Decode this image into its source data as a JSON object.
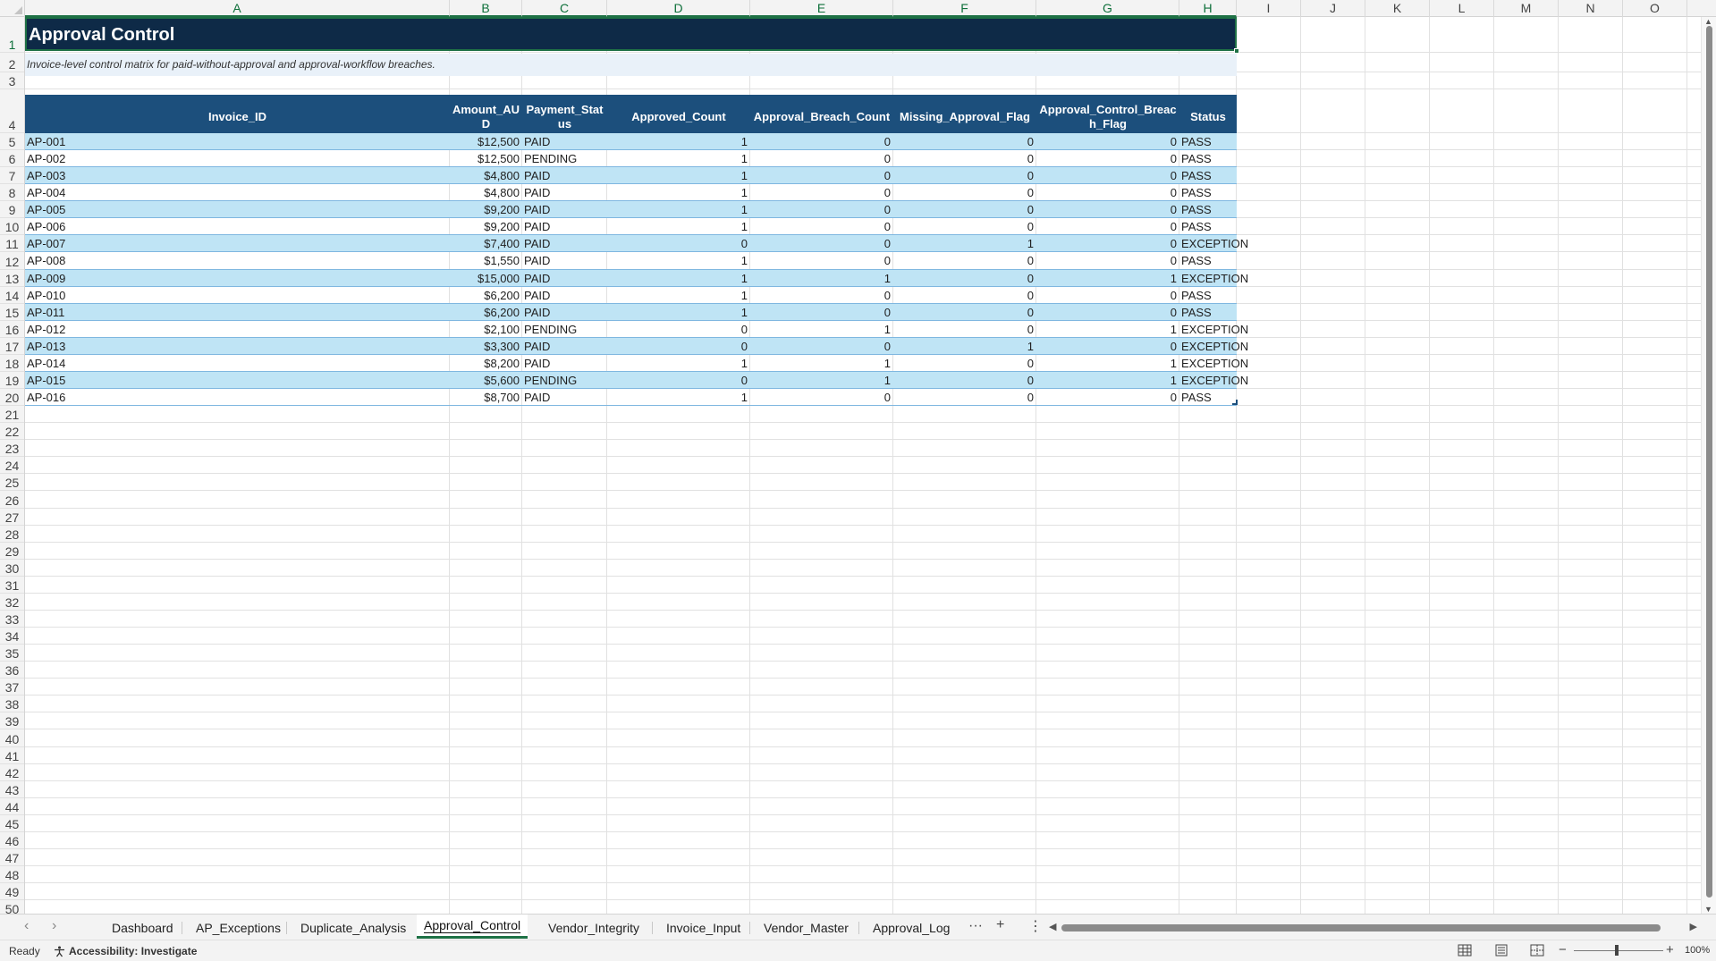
{
  "sheet": {
    "title": "Approval Control",
    "subtitle": "Invoice-level control matrix for paid-without-approval and approval-workflow breaches."
  },
  "columns": [
    "A",
    "B",
    "C",
    "D",
    "E",
    "F",
    "G",
    "H",
    "I",
    "J",
    "K",
    "L",
    "M",
    "N",
    "O"
  ],
  "row_numbers": [
    "1",
    "2",
    "3",
    "4",
    "5",
    "6",
    "7",
    "8",
    "9",
    "10",
    "11",
    "12",
    "13",
    "14",
    "15",
    "16",
    "17",
    "18",
    "19",
    "20",
    "21",
    "22",
    "23",
    "24",
    "25",
    "26",
    "27",
    "28",
    "29",
    "30",
    "31",
    "32",
    "33",
    "34",
    "35",
    "36",
    "37",
    "38",
    "39",
    "40",
    "41",
    "42",
    "43",
    "44",
    "45",
    "46",
    "47",
    "48",
    "49",
    "50"
  ],
  "table": {
    "headers": [
      "Invoice_ID",
      "Amount_AUD",
      "Payment_Status",
      "Approved_Count",
      "Approval_Breach_Count",
      "Missing_Approval_Flag",
      "Approval_Control_Breach_Flag",
      "Status"
    ],
    "header_display": [
      "Invoice_ID",
      "Amount_AU\nD",
      "Payment_Stat\nus",
      "Approved_Count",
      "Approval_Breach_Count",
      "Missing_Approval_Flag",
      "Approval_Control_Breac\nh_Flag",
      "Status"
    ],
    "rows": [
      [
        "AP-001",
        "$12,500",
        "PAID",
        "1",
        "0",
        "0",
        "0",
        "PASS"
      ],
      [
        "AP-002",
        "$12,500",
        "PENDING",
        "1",
        "0",
        "0",
        "0",
        "PASS"
      ],
      [
        "AP-003",
        "$4,800",
        "PAID",
        "1",
        "0",
        "0",
        "0",
        "PASS"
      ],
      [
        "AP-004",
        "$4,800",
        "PAID",
        "1",
        "0",
        "0",
        "0",
        "PASS"
      ],
      [
        "AP-005",
        "$9,200",
        "PAID",
        "1",
        "0",
        "0",
        "0",
        "PASS"
      ],
      [
        "AP-006",
        "$9,200",
        "PAID",
        "1",
        "0",
        "0",
        "0",
        "PASS"
      ],
      [
        "AP-007",
        "$7,400",
        "PAID",
        "0",
        "0",
        "1",
        "0",
        "EXCEPTION"
      ],
      [
        "AP-008",
        "$1,550",
        "PAID",
        "1",
        "0",
        "0",
        "0",
        "PASS"
      ],
      [
        "AP-009",
        "$15,000",
        "PAID",
        "1",
        "1",
        "0",
        "1",
        "EXCEPTION"
      ],
      [
        "AP-010",
        "$6,200",
        "PAID",
        "1",
        "0",
        "0",
        "0",
        "PASS"
      ],
      [
        "AP-011",
        "$6,200",
        "PAID",
        "1",
        "0",
        "0",
        "0",
        "PASS"
      ],
      [
        "AP-012",
        "$2,100",
        "PENDING",
        "0",
        "1",
        "0",
        "1",
        "EXCEPTION"
      ],
      [
        "AP-013",
        "$3,300",
        "PAID",
        "0",
        "0",
        "1",
        "0",
        "EXCEPTION"
      ],
      [
        "AP-014",
        "$8,200",
        "PAID",
        "1",
        "1",
        "0",
        "1",
        "EXCEPTION"
      ],
      [
        "AP-015",
        "$5,600",
        "PENDING",
        "0",
        "1",
        "0",
        "1",
        "EXCEPTION"
      ],
      [
        "AP-016",
        "$8,700",
        "PAID",
        "1",
        "0",
        "0",
        "0",
        "PASS"
      ]
    ]
  },
  "tabs": {
    "items": [
      "Dashboard",
      "AP_Exceptions",
      "Duplicate_Analysis",
      "Approval_Control",
      "Vendor_Integrity",
      "Invoice_Input",
      "Vendor_Master",
      "Approval_Log"
    ],
    "active": "Approval_Control",
    "more_label": "···",
    "add_label": "+",
    "options_label": "⋮"
  },
  "statusbar": {
    "ready": "Ready",
    "accessibility": "Accessibility: Investigate",
    "zoom": "100%"
  },
  "colors": {
    "title_bg": "#0e2a47",
    "header_bg": "#1c4f7c",
    "band_row": "#bfe4f5",
    "subtitle_bg": "#e9f1f9",
    "selection": "#1e7145"
  }
}
